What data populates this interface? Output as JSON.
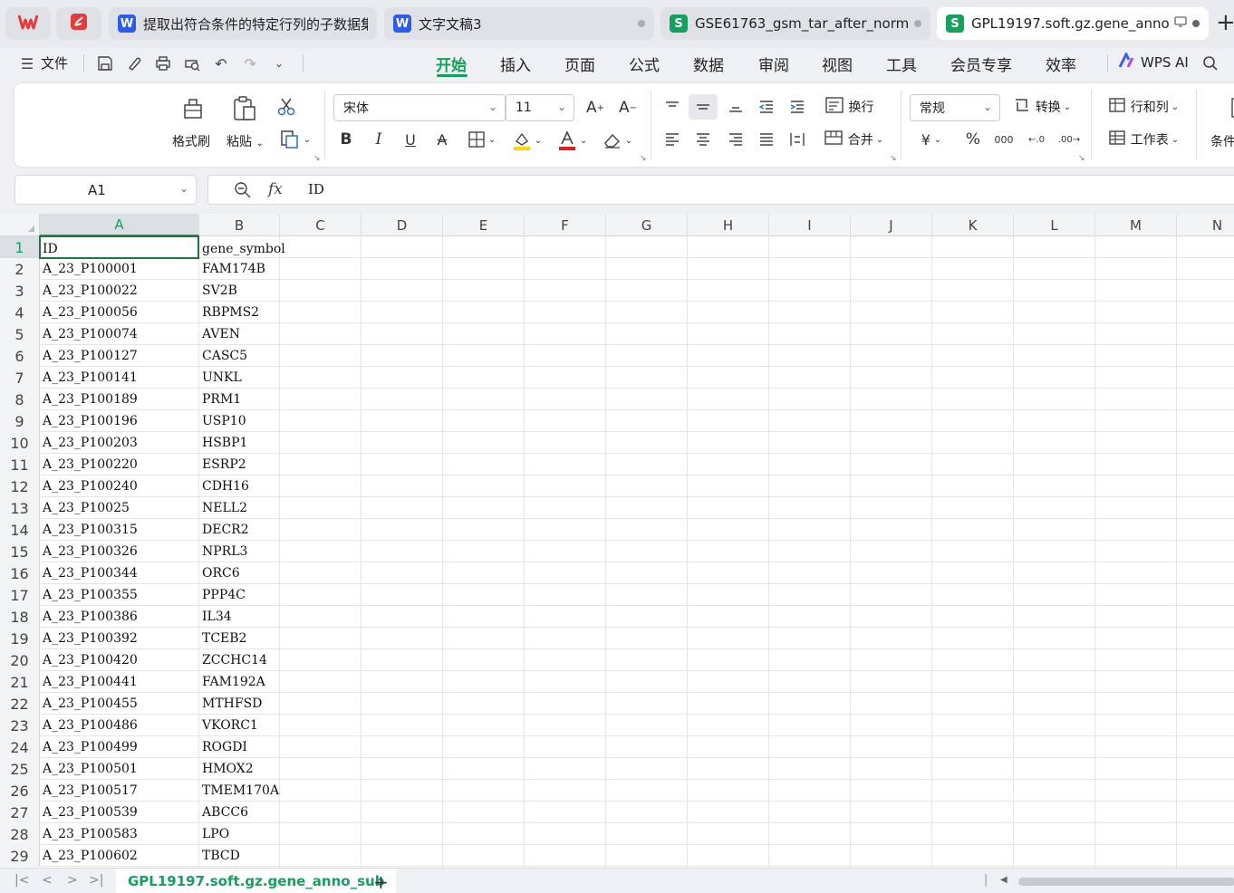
{
  "tabs": [
    {
      "icon": "W",
      "icon_type": "w",
      "title": "提取出符合条件的特定行列的子数据集",
      "active": false
    },
    {
      "icon": "W",
      "icon_type": "w",
      "title": "文字文稿3",
      "active": false
    },
    {
      "icon": "S",
      "icon_type": "s",
      "title": "GSE61763_gsm_tar_after_norm_",
      "active": false
    },
    {
      "icon": "S",
      "icon_type": "s",
      "title": "GPL19197.soft.gz.gene_anno",
      "active": true
    }
  ],
  "menu": {
    "file_label": "文件",
    "items": [
      "开始",
      "插入",
      "页面",
      "公式",
      "数据",
      "审阅",
      "视图",
      "工具",
      "会员专享",
      "效率"
    ],
    "active": "开始",
    "wps_ai": "WPS AI"
  },
  "ribbon": {
    "format_painter": "格式刷",
    "paste": "粘贴",
    "font_name": "宋体",
    "font_size": "11",
    "wrap": "换行",
    "merge": "合并",
    "number_format": "常规",
    "convert": "转换",
    "row_col": "行和列",
    "worksheet": "工作表",
    "cond": "条件"
  },
  "formula_bar": {
    "cell_ref": "A1",
    "fx": "fx",
    "content": "ID"
  },
  "columns": [
    "A",
    "B",
    "C",
    "D",
    "E",
    "F",
    "G",
    "H",
    "I",
    "J",
    "K",
    "L",
    "M",
    "N"
  ],
  "active_column": "A",
  "rows": [
    [
      "ID",
      "gene_symbol"
    ],
    [
      "A_23_P100001",
      "FAM174B"
    ],
    [
      "A_23_P100022",
      "SV2B"
    ],
    [
      "A_23_P100056",
      "RBPMS2"
    ],
    [
      "A_23_P100074",
      "AVEN"
    ],
    [
      "A_23_P100127",
      "CASC5"
    ],
    [
      "A_23_P100141",
      "UNKL"
    ],
    [
      "A_23_P100189",
      "PRM1"
    ],
    [
      "A_23_P100196",
      "USP10"
    ],
    [
      "A_23_P100203",
      "HSBP1"
    ],
    [
      "A_23_P100220",
      "ESRP2"
    ],
    [
      "A_23_P100240",
      "CDH16"
    ],
    [
      "A_23_P10025",
      "NELL2"
    ],
    [
      "A_23_P100315",
      "DECR2"
    ],
    [
      "A_23_P100326",
      "NPRL3"
    ],
    [
      "A_23_P100344",
      "ORC6"
    ],
    [
      "A_23_P100355",
      "PPP4C"
    ],
    [
      "A_23_P100386",
      "IL34"
    ],
    [
      "A_23_P100392",
      "TCEB2"
    ],
    [
      "A_23_P100420",
      "ZCCHC14"
    ],
    [
      "A_23_P100441",
      "FAM192A"
    ],
    [
      "A_23_P100455",
      "MTHFSD"
    ],
    [
      "A_23_P100486",
      "VKORC1"
    ],
    [
      "A_23_P100499",
      "ROGDI"
    ],
    [
      "A_23_P100501",
      "HMOX2"
    ],
    [
      "A_23_P100517",
      "TMEM170A"
    ],
    [
      "A_23_P100539",
      "ABCC6"
    ],
    [
      "A_23_P100583",
      "LPO"
    ],
    [
      "A_23_P100602",
      "TBCD"
    ]
  ],
  "sheet_tab": "GPL19197.soft.gz.gene_anno_sub",
  "colors": {
    "accent": "#16a05d",
    "selection": "#1a7a3e",
    "wps_red": "#e8393b",
    "font_color_bar": "#e02020",
    "highlight_bar": "#f5d90a"
  }
}
